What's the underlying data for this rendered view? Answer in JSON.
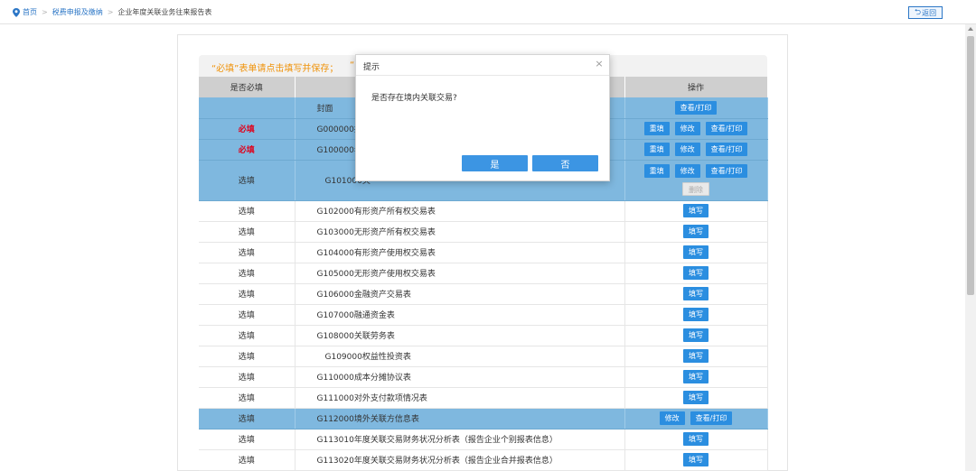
{
  "breadcrumb": {
    "home": "首页",
    "section": "税费申报及缴纳",
    "current": "企业年度关联业务往来报告表"
  },
  "back_label": "返回",
  "notice": {
    "text": "“必填”表单请点击填写并保存；",
    "text_trailing": "“"
  },
  "table": {
    "headers": [
      "是否必填",
      "",
      "操作"
    ],
    "rows": [
      {
        "required": "",
        "name": "封面",
        "ops": [
          "查看/打印"
        ],
        "highlight": true
      },
      {
        "required": "必填",
        "name": "G000000报告",
        "ops": [
          "重填",
          "修改",
          "查看/打印"
        ],
        "highlight": true
      },
      {
        "required": "必填",
        "name": "G100000年",
        "ops": [
          "重填",
          "修改",
          "查看/打印"
        ],
        "highlight": true
      },
      {
        "required": "选填",
        "name": "G101000关",
        "ops": [
          "重填",
          "修改",
          "查看/打印",
          "删除"
        ],
        "highlight": true
      },
      {
        "required": "选填",
        "name": "G102000有形资产所有权交易表",
        "ops": [
          "填写"
        ]
      },
      {
        "required": "选填",
        "name": "G103000无形资产所有权交易表",
        "ops": [
          "填写"
        ]
      },
      {
        "required": "选填",
        "name": "G104000有形资产使用权交易表",
        "ops": [
          "填写"
        ]
      },
      {
        "required": "选填",
        "name": "G105000无形资产使用权交易表",
        "ops": [
          "填写"
        ]
      },
      {
        "required": "选填",
        "name": "G106000金融资产交易表",
        "ops": [
          "填写"
        ]
      },
      {
        "required": "选填",
        "name": "G107000融通资金表",
        "ops": [
          "填写"
        ]
      },
      {
        "required": "选填",
        "name": "G108000关联劳务表",
        "ops": [
          "填写"
        ]
      },
      {
        "required": "选填",
        "name": "G109000权益性投资表",
        "ops": [
          "填写"
        ]
      },
      {
        "required": "选填",
        "name": "G110000成本分摊协议表",
        "ops": [
          "填写"
        ]
      },
      {
        "required": "选填",
        "name": "G111000对外支付款项情况表",
        "ops": [
          "填写"
        ]
      },
      {
        "required": "选填",
        "name": "G112000境外关联方信息表",
        "ops": [
          "修改",
          "查看/打印"
        ],
        "highlight": true
      },
      {
        "required": "选填",
        "name": "G113010年度关联交易财务状况分析表（报告企业个别报表信息）",
        "ops": [
          "填写"
        ]
      },
      {
        "required": "选填",
        "name": "G113020年度关联交易财务状况分析表（报告企业合并报表信息）",
        "ops": [
          "填写"
        ]
      }
    ]
  },
  "modal": {
    "title": "提示",
    "close_glyph": "×",
    "message": "是否存在境内关联交易?",
    "yes_label": "是",
    "no_label": "否"
  },
  "colors": {
    "accent": "#2b8ee0",
    "highlight_row": "#7fb8df",
    "required_red": "#e0001b",
    "notice_orange": "#f0930b"
  },
  "icons": {
    "location": "location-pin-icon",
    "back": "back-arrow-icon",
    "close": "close-icon"
  }
}
